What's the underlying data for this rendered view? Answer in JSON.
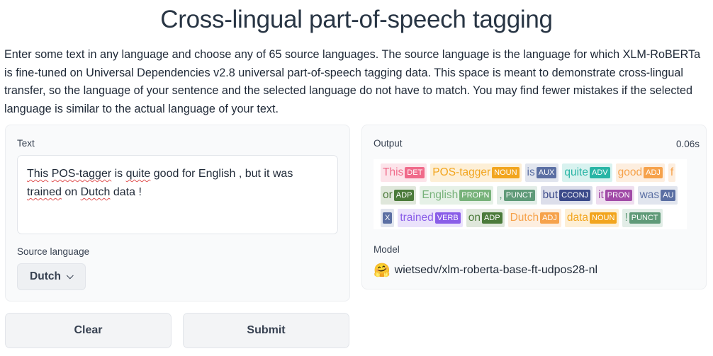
{
  "page": {
    "title": "Cross-lingual part-of-speech tagging",
    "description": "Enter some text in any language and choose any of 65 source languages. The source language is the language for which XLM-RoBERTa is fine-tuned on Universal Dependencies v2.8 universal part-of-speech tagging data. This space is meant to demonstrate cross-lingual transfer, so the language of your sentence and the selected language do not have to match. You may find fewer mistakes if the selected language is similar to the actual language of your text."
  },
  "input_panel": {
    "text_label": "Text",
    "text_value": "This POS-tagger is quite good for English , but it was trained on Dutch data !",
    "text_segments": [
      {
        "t": "This",
        "spell": true
      },
      {
        "t": " "
      },
      {
        "t": "POS-tagger",
        "spell": true
      },
      {
        "t": " is "
      },
      {
        "t": "quite",
        "spell": true
      },
      {
        "t": " good for English , but it was "
      },
      {
        "t": "trained",
        "spell": true
      },
      {
        "t": " on "
      },
      {
        "t": "Dutch",
        "spell": true
      },
      {
        "t": " data !"
      }
    ],
    "source_label": "Source language",
    "source_value": "Dutch",
    "dropdown_icon": "chevron-down-icon"
  },
  "buttons": {
    "clear": "Clear",
    "submit": "Submit"
  },
  "output_panel": {
    "output_label": "Output",
    "elapsed": "0.06s",
    "model_label": "Model",
    "model_icon": "hugging-face-icon",
    "model_name": "wietsedv/xlm-roberta-base-ft-udpos28-nl",
    "tag_colors": {
      "DET": "#f06a8a",
      "NOUN": "#f2a51e",
      "AUX": "#5b6fa3",
      "ADV": "#28b5a5",
      "ADJ": "#f6a24b",
      "ADP": "#4b7a3a",
      "PROPN": "#77b27a",
      "PUNCT": "#5f9a78",
      "CCONJ": "#3b4a8a",
      "PRON": "#a14aa7",
      "VERB": "#8a5de8"
    },
    "tag_rows": [
      [
        {
          "word": "This",
          "label": "DET"
        },
        {
          "word": "POS-tagger",
          "label": "NOUN"
        },
        {
          "word": "is",
          "label": "AUX"
        },
        {
          "word": "quite",
          "label": "ADV"
        },
        {
          "word": "good",
          "label": "ADJ"
        },
        {
          "word": "f",
          "label": ""
        }
      ],
      [
        {
          "word": "or",
          "label": "ADP"
        },
        {
          "word": "English",
          "label": "PROPN"
        },
        {
          "word": ",",
          "label": "PUNCT"
        },
        {
          "word": "but",
          "label": "CCONJ"
        },
        {
          "word": "it",
          "label": "PRON"
        },
        {
          "word": "was",
          "label": "AU"
        }
      ],
      [
        {
          "word": "",
          "label": "X"
        },
        {
          "word": "trained",
          "label": "VERB"
        },
        {
          "word": "on",
          "label": "ADP"
        },
        {
          "word": "Dutch",
          "label": "ADJ"
        },
        {
          "word": "data",
          "label": "NOUN"
        },
        {
          "word": "!",
          "label": "PUNCT"
        }
      ]
    ]
  }
}
